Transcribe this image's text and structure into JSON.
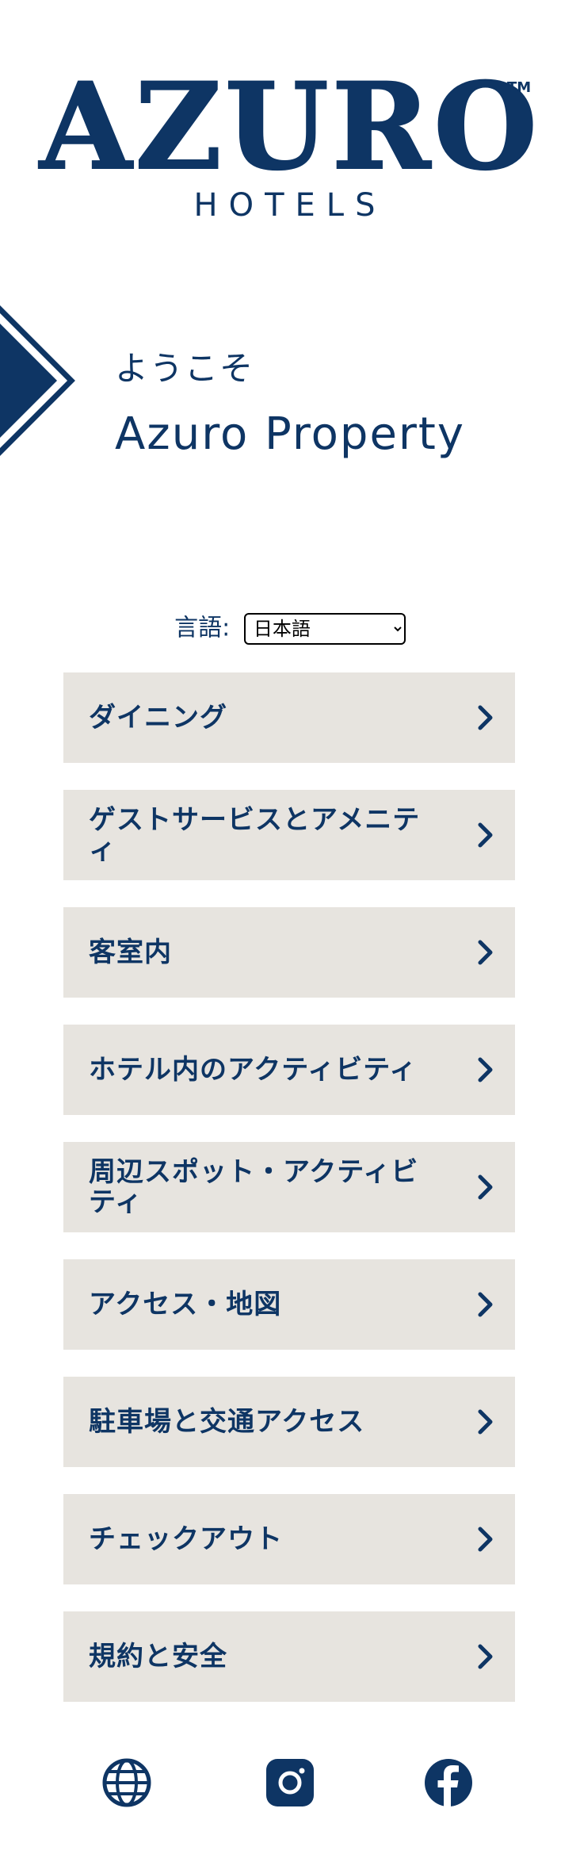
{
  "brand": {
    "name": "AZURO",
    "trademark": "TM",
    "subtitle": "HOTELS"
  },
  "welcome": {
    "greeting": "ようこそ",
    "property": "Azuro Property"
  },
  "language": {
    "label": "言語:",
    "selected": "日本語"
  },
  "menu": [
    {
      "label": "ダイニング"
    },
    {
      "label": "ゲストサービスとアメニティ"
    },
    {
      "label": "客室内"
    },
    {
      "label": "ホテル内のアクティビティ"
    },
    {
      "label": "周辺スポット・アクティビティ"
    },
    {
      "label": "アクセス・地図"
    },
    {
      "label": "駐車場と交通アクセス"
    },
    {
      "label": "チェックアウト"
    },
    {
      "label": "規約と安全"
    }
  ],
  "footer": {
    "icons": [
      "globe-icon",
      "instagram-icon",
      "facebook-icon"
    ]
  },
  "colors": {
    "brand_navy": "#0e3564",
    "tile_background": "#e7e4df",
    "page_background": "#ffffff"
  }
}
